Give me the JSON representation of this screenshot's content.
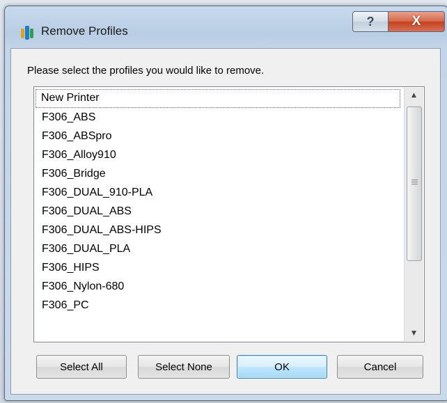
{
  "window": {
    "title": "Remove Profiles",
    "help_glyph": "?",
    "close_glyph": "X"
  },
  "prompt": "Please select the profiles you would like to remove.",
  "profiles": [
    "New Printer",
    "F306_ABS",
    "F306_ABSpro",
    "F306_Alloy910",
    "F306_Bridge",
    "F306_DUAL_910-PLA",
    "F306_DUAL_ABS",
    "F306_DUAL_ABS-HIPS",
    "F306_DUAL_PLA",
    "F306_HIPS",
    "F306_Nylon-680",
    "F306_PC"
  ],
  "buttons": {
    "select_all": "Select All",
    "select_none": "Select None",
    "ok": "OK",
    "cancel": "Cancel"
  },
  "icons": {
    "app": "app-logo-icon",
    "help": "help-icon",
    "close": "close-icon"
  },
  "colors": {
    "close_button": "#c2401f",
    "default_button_border": "#3c7fb1"
  }
}
